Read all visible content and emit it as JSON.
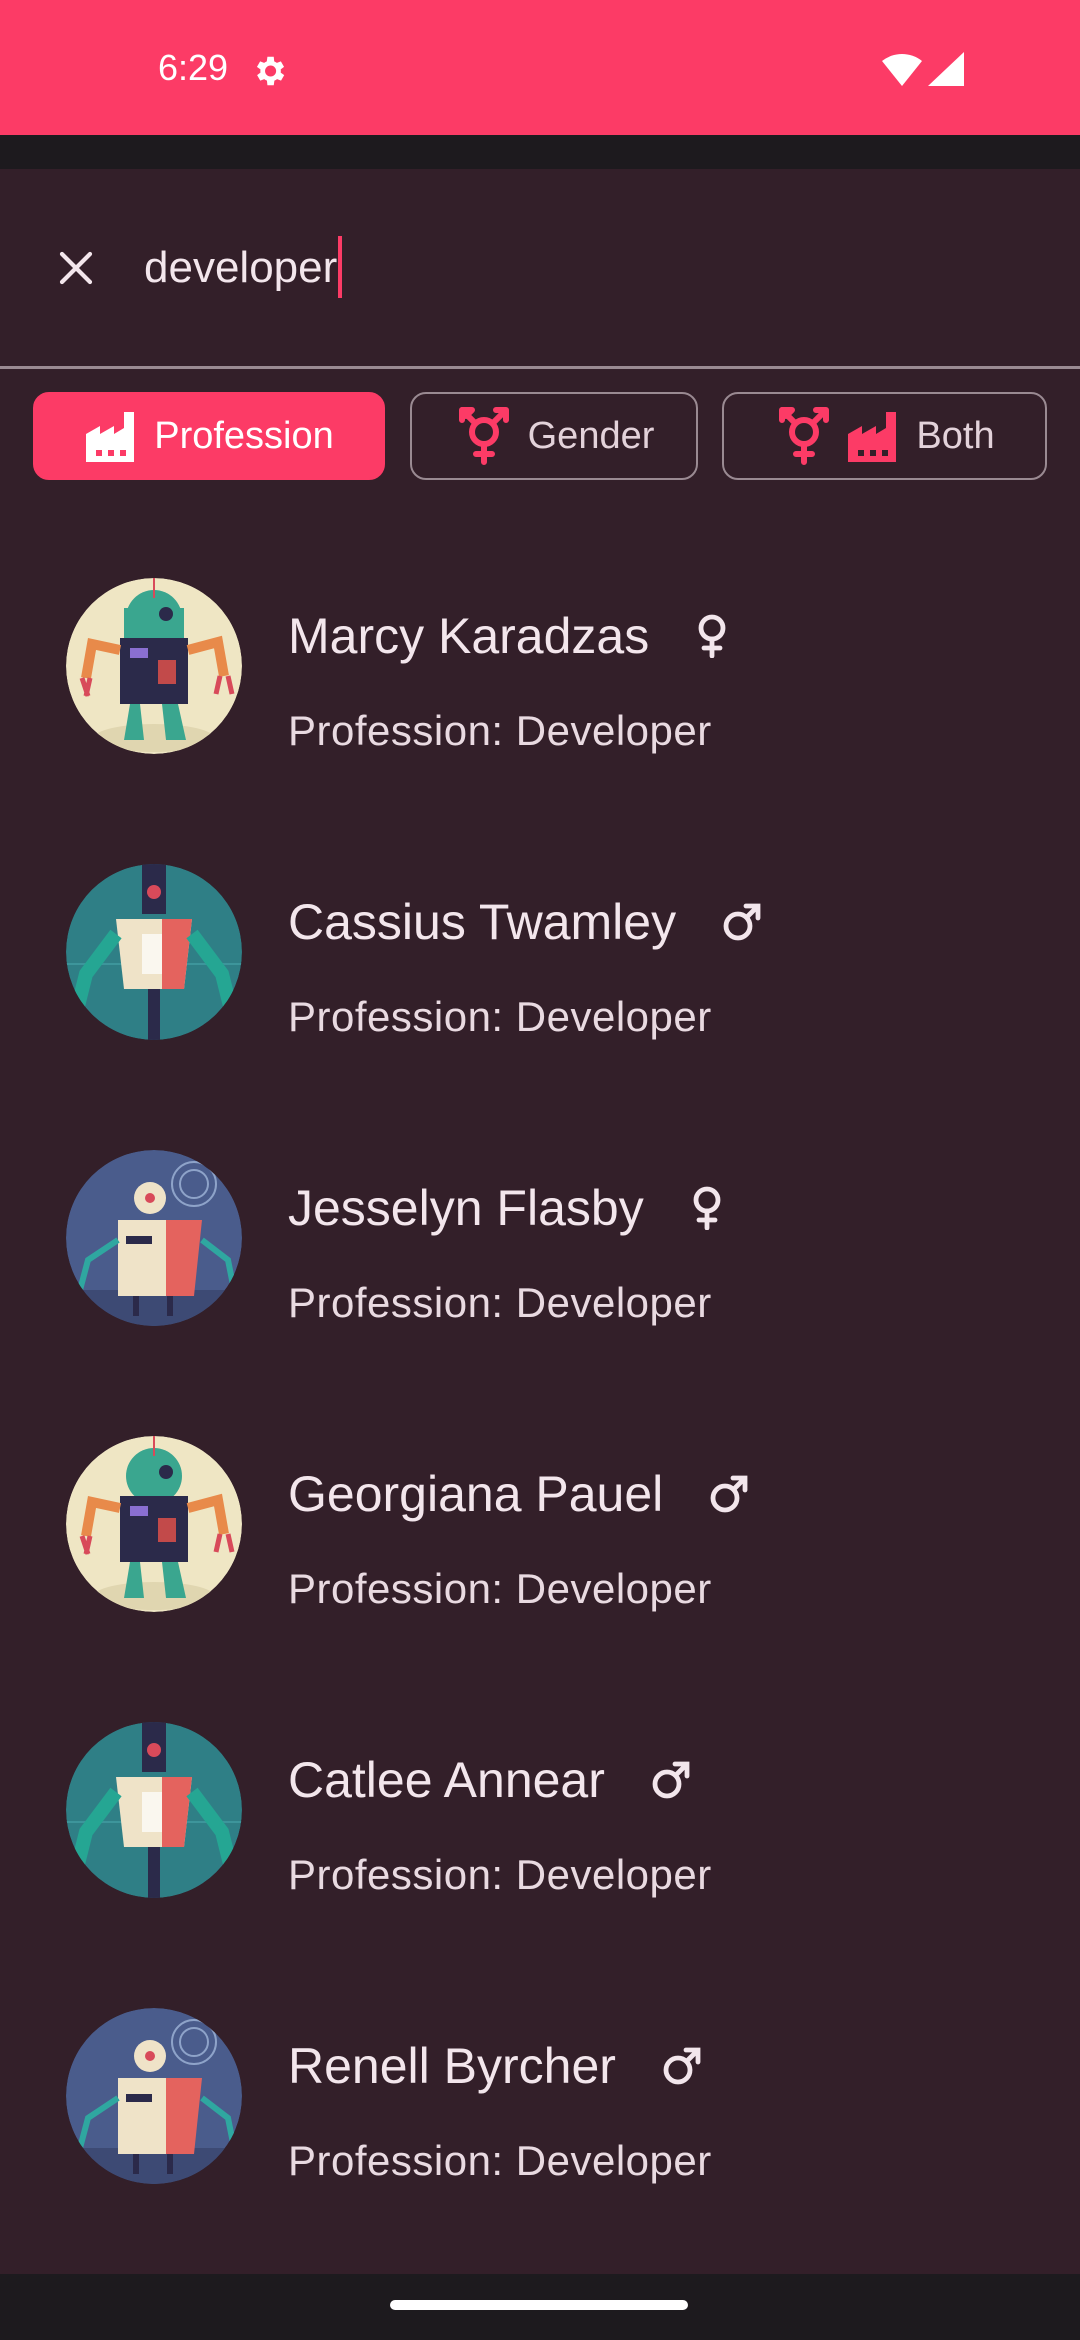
{
  "status_bar": {
    "time": "6:29",
    "icons": [
      "settings-gear-icon",
      "wifi-icon",
      "cellular-signal-icon"
    ]
  },
  "search": {
    "close_icon": "close-icon",
    "query": "developer"
  },
  "filters": {
    "profession": {
      "label": "Profession",
      "selected": true,
      "icons": [
        "factory-icon"
      ]
    },
    "gender": {
      "label": "Gender",
      "selected": false,
      "icons": [
        "gender-symbol-icon"
      ]
    },
    "both": {
      "label": "Both",
      "selected": false,
      "icons": [
        "gender-symbol-icon",
        "factory-icon"
      ]
    }
  },
  "results": [
    {
      "name": "Marcy Karadzas",
      "gender": "female",
      "gender_icon": "female-icon",
      "profession": "Profession: Developer",
      "avatar": "robot-a"
    },
    {
      "name": "Cassius Twamley",
      "gender": "male",
      "gender_icon": "male-icon",
      "profession": "Profession: Developer",
      "avatar": "robot-b"
    },
    {
      "name": "Jesselyn Flasby",
      "gender": "female",
      "gender_icon": "female-icon",
      "profession": "Profession: Developer",
      "avatar": "robot-c"
    },
    {
      "name": "Georgiana Pauel",
      "gender": "male",
      "gender_icon": "male-icon",
      "profession": "Profession: Developer",
      "avatar": "robot-a"
    },
    {
      "name": "Catlee Annear",
      "gender": "male",
      "gender_icon": "male-icon",
      "profession": "Profession: Developer",
      "avatar": "robot-b"
    },
    {
      "name": "Renell Byrcher",
      "gender": "male",
      "gender_icon": "male-icon",
      "profession": "Profession: Developer",
      "avatar": "robot-c"
    }
  ],
  "colors": {
    "accent": "#fc3b66",
    "background": "#331f29",
    "text": "#f3e6ec",
    "outline": "#9a8a92"
  }
}
